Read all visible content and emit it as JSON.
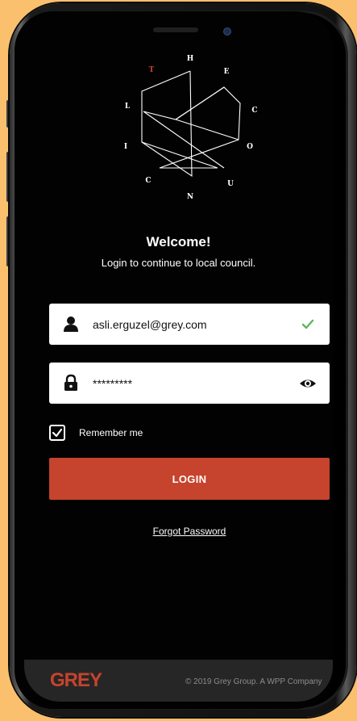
{
  "logo": {
    "letters": [
      "T",
      "H",
      "E",
      "C",
      "O",
      "U",
      "N",
      "C",
      "I",
      "L"
    ],
    "highlight_color": "#C6432D"
  },
  "welcome": {
    "title": "Welcome!",
    "subtitle": "Login to continue to local council."
  },
  "email_field": {
    "value": "asli.erguzel@grey.com",
    "icon": "user-icon",
    "status_icon": "check-icon",
    "status_color": "#5CB85C"
  },
  "password_field": {
    "value": "*********",
    "icon": "lock-icon",
    "toggle_icon": "eye-icon"
  },
  "remember": {
    "label": "Remember me",
    "checked": true
  },
  "login_button": {
    "label": "LOGIN",
    "color": "#C6432D"
  },
  "forgot_password": {
    "label": "Forgot Password"
  },
  "footer": {
    "brand": "GREY",
    "copyright": "© 2019 Grey Group. A WPP Company"
  }
}
